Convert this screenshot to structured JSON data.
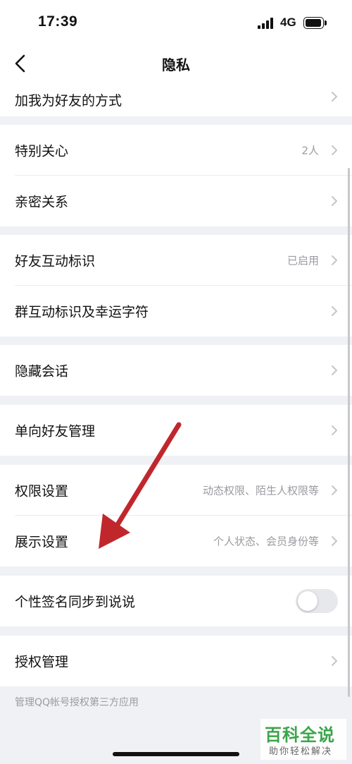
{
  "status_bar": {
    "time": "17:39",
    "network": "4G"
  },
  "nav": {
    "title": "隐私",
    "back_icon": "chevron-left-icon"
  },
  "rows": {
    "add_friend_method": {
      "label": "加我为好友的方式"
    },
    "special_care": {
      "label": "特别关心",
      "value": "2人"
    },
    "intimate": {
      "label": "亲密关系"
    },
    "friend_badges": {
      "label": "好友互动标识",
      "value": "已启用"
    },
    "group_badges": {
      "label": "群互动标识及幸运字符"
    },
    "hidden_chats": {
      "label": "隐藏会话"
    },
    "one_way_friends": {
      "label": "单向好友管理"
    },
    "permissions": {
      "label": "权限设置",
      "value": "动态权限、陌生人权限等"
    },
    "display": {
      "label": "展示设置",
      "value": "个人状态、会员身份等"
    },
    "signature_sync": {
      "label": "个性签名同步到说说",
      "toggle_on": false
    },
    "authorization": {
      "label": "授权管理"
    }
  },
  "footnote": "管理QQ帐号授权第三方应用",
  "watermark": {
    "main": "百科全说",
    "sub": "助你轻松解决"
  },
  "colors": {
    "background": "#f0f1f5",
    "card": "#ffffff",
    "secondary_text": "#9a9ba0",
    "annotation_arrow": "#c0272d",
    "watermark_green": "#3aa54a"
  }
}
